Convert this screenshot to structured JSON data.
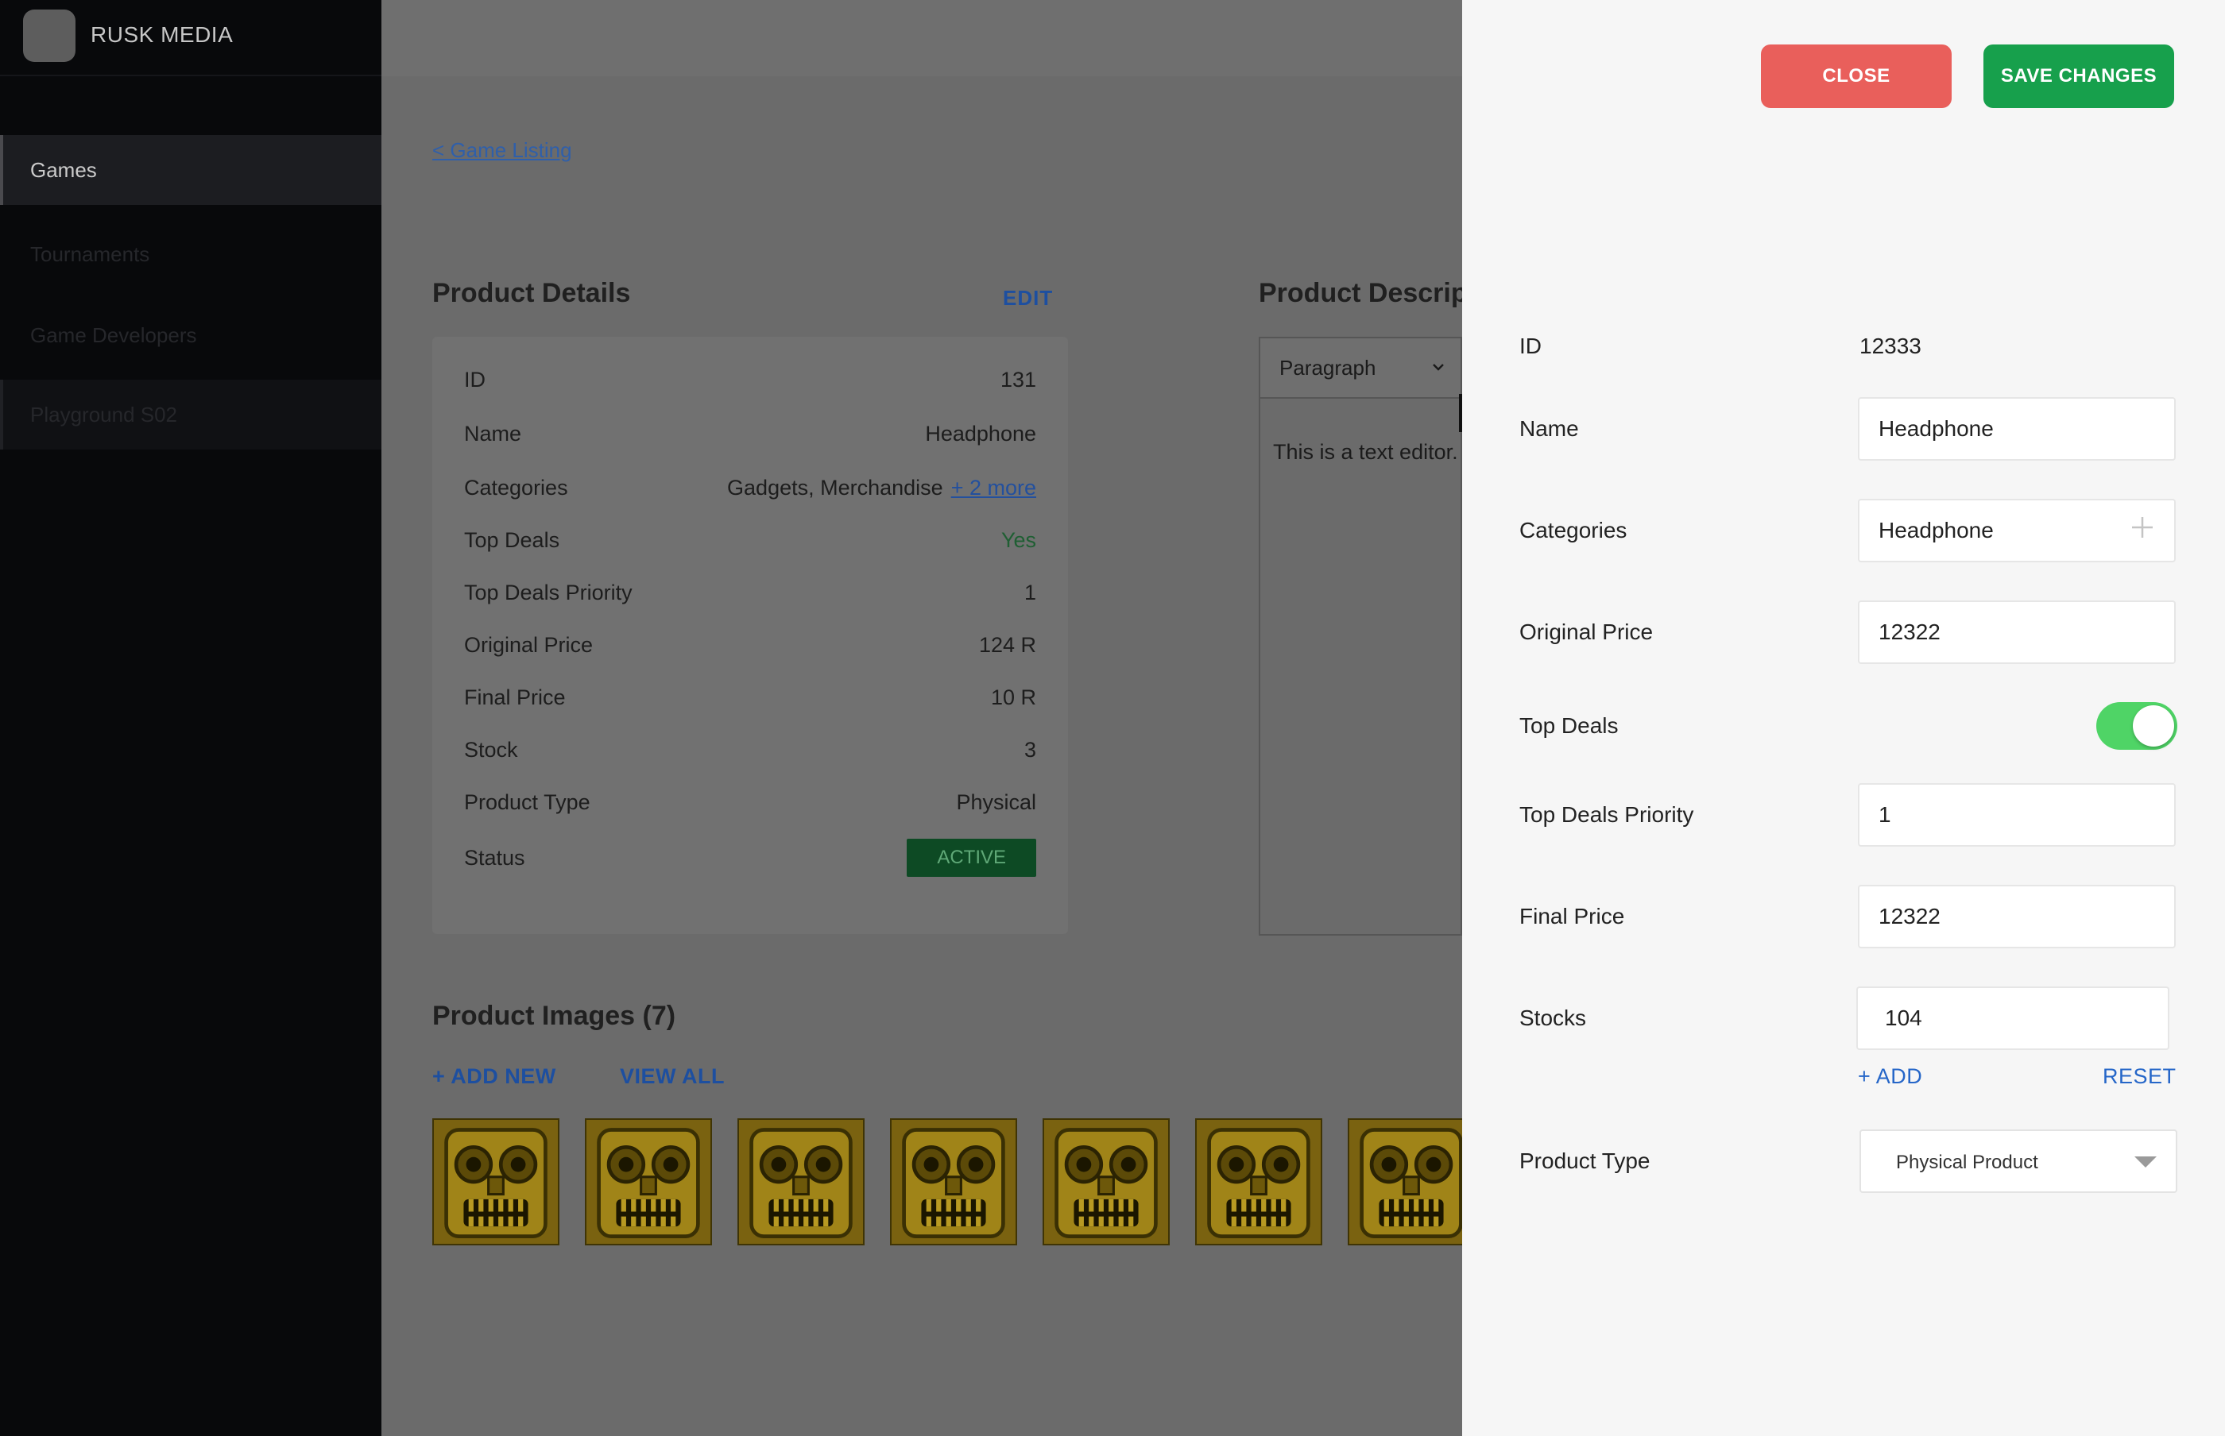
{
  "brand": {
    "name": "RUSK MEDIA"
  },
  "sidebar": {
    "items": [
      {
        "label": "Games"
      },
      {
        "label": "Tournaments"
      },
      {
        "label": "Game Developers"
      },
      {
        "label": "Playground S02"
      }
    ]
  },
  "breadcrumb": {
    "back_label": "< Game Listing"
  },
  "product_details": {
    "title": "Product Details",
    "edit_label": "EDIT",
    "rows": [
      {
        "label": "ID",
        "value": "131"
      },
      {
        "label": "Name",
        "value": "Headphone"
      },
      {
        "label": "Categories",
        "value": "Gadgets, Merchandise",
        "more": "+ 2 more"
      },
      {
        "label": "Top Deals",
        "value": "Yes"
      },
      {
        "label": "Top Deals Priority",
        "value": "1"
      },
      {
        "label": "Original Price",
        "value": "124 R"
      },
      {
        "label": "Final Price",
        "value": "10 R"
      },
      {
        "label": "Stock",
        "value": "3"
      },
      {
        "label": "Product Type",
        "value": "Physical"
      },
      {
        "label": "Status",
        "value": "ACTIVE"
      }
    ]
  },
  "product_description": {
    "title": "Product Description",
    "format_option": "Paragraph",
    "body": "This is a text editor."
  },
  "product_images": {
    "title": "Product Images (7)",
    "add_label": "+ ADD NEW",
    "view_all_label": "VIEW ALL",
    "count": 7
  },
  "drawer": {
    "close_label": "CLOSE",
    "save_label": "SAVE CHANGES",
    "id_label": "ID",
    "id_value": "12333",
    "name_label": "Name",
    "name_value": "Headphone",
    "categories_label": "Categories",
    "categories_value": "Headphone",
    "original_price_label": "Original Price",
    "original_price_value": "12322",
    "top_deals_label": "Top Deals",
    "top_deals_on": true,
    "top_deals_priority_label": "Top Deals Priority",
    "top_deals_priority_value": "1",
    "final_price_label": "Final Price",
    "final_price_value": "12322",
    "stocks_label": "Stocks",
    "stocks_value": "104",
    "stocks_add_label": "+ ADD",
    "stocks_reset_label": "RESET",
    "product_type_label": "Product Type",
    "product_type_value": "Physical Product"
  },
  "colors": {
    "close_button": "#e95f5b",
    "save_button": "#17a04c",
    "toggle_on": "#4fd466",
    "link_blue": "#2566c8"
  }
}
